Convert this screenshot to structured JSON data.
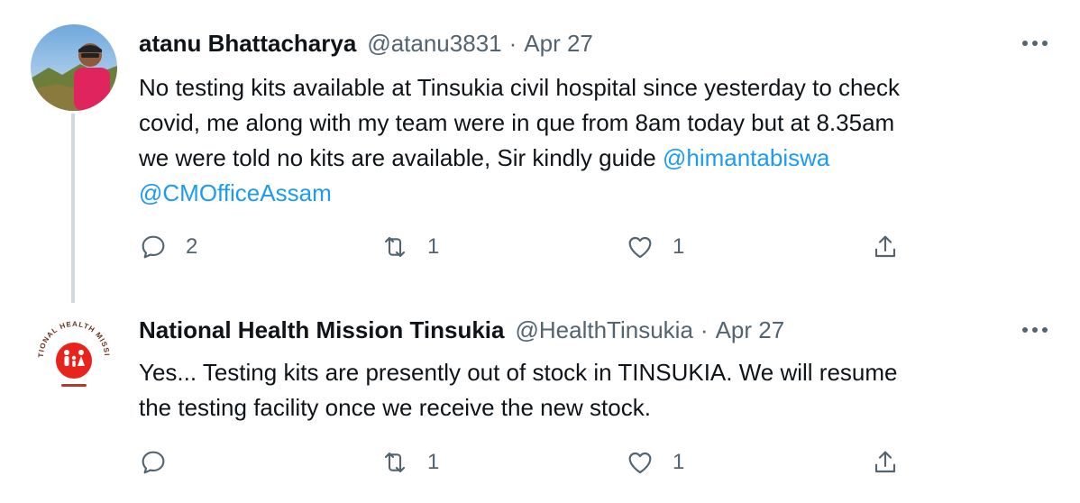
{
  "tweets": [
    {
      "avatar_icon": "user-photo",
      "name": "atanu Bhattacharya",
      "handle": "@atanu3831",
      "separator": "·",
      "time": "Apr 27",
      "text_lines": [
        "No testing kits available at Tinsukia civil hospital since yesterday to check",
        "covid, me along with my team were in que from 8am today but at 8.35am",
        "we were told no kits are available, Sir kindly guide "
      ],
      "mentions": [
        "@himantabiswa",
        "@CMOfficeAssam"
      ],
      "actions": {
        "reply": "2",
        "retweet": "1",
        "like": "1"
      }
    },
    {
      "avatar_icon": "national-health-mission-logo",
      "avatar_logo_text": "NATIONAL HEALTH MISSION",
      "name": "National Health Mission Tinsukia",
      "handle": "@HealthTinsukia",
      "separator": "·",
      "time": "Apr 27",
      "text_lines": [
        "Yes... Testing kits are presently out of stock in TINSUKIA. We will resume",
        "the testing facility once we receive the new stock."
      ],
      "actions": {
        "reply": "",
        "retweet": "1",
        "like": "1"
      }
    }
  ],
  "colors": {
    "text": "#0f1419",
    "muted": "#536471",
    "link": "#1d9bf0",
    "thread_line": "#cfd9de",
    "logo_red": "#e8221c"
  }
}
